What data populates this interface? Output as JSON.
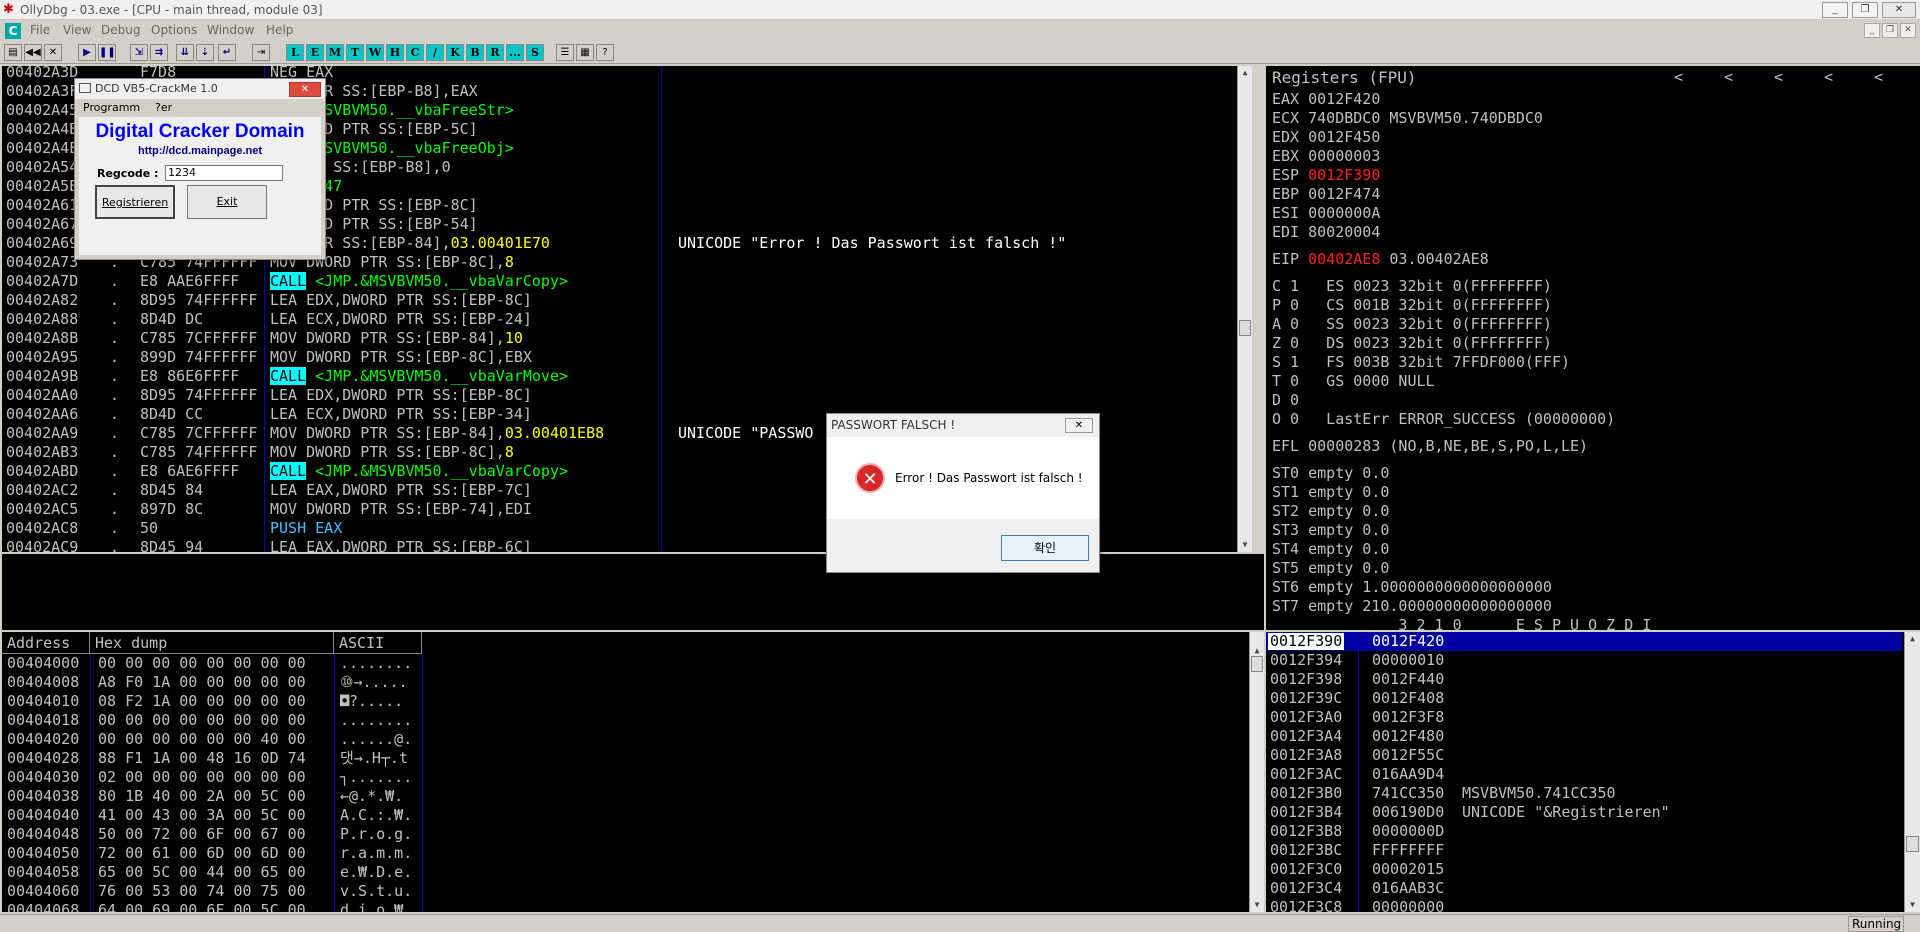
{
  "app": {
    "title": "OllyDbg - 03.exe - [CPU - main thread, module 03]",
    "menu": [
      "File",
      "View",
      "Debug",
      "Options",
      "Window",
      "Help"
    ],
    "mdi_icon": "C",
    "toolbar_letters": [
      "L",
      "E",
      "M",
      "T",
      "W",
      "H",
      "C",
      "/",
      "K",
      "B",
      "R",
      "...",
      "S"
    ]
  },
  "disasm": {
    "rows": [
      {
        "addr": "00402A3D",
        "m": "",
        "hex": "F7D8",
        "cmd": "NEG EAX",
        "cmt": ""
      },
      {
        "addr": "00402A3F",
        "m": "",
        "hex": "",
        "cmd": "ORD PTR SS:[EBP-B8],EAX",
        "cmt": ""
      },
      {
        "addr": "00402A45",
        "m": "",
        "hex": "",
        "cmd": "JMP.&MSVBVM50.__vbaFreeStr>",
        "cmt": ""
      },
      {
        "addr": "00402A4B",
        "m": "",
        "hex": "",
        "cmd": "X,DWORD PTR SS:[EBP-5C]",
        "cmt": ""
      },
      {
        "addr": "00402A4E",
        "m": "",
        "hex": "",
        "cmd": "JMP.&MSVBVM50.__vbaFreeObj>",
        "cmt": ""
      },
      {
        "addr": "00402A54",
        "m": "",
        "hex": "",
        "cmd": "RD PTR SS:[EBP-B8],0",
        "cmt": ""
      },
      {
        "addr": "00402A5B",
        "m": "",
        "hex": "",
        "cmd": "00402B47",
        "cmt": ""
      },
      {
        "addr": "00402A61",
        "m": "",
        "hex": "",
        "cmd": "X,DWORD PTR SS:[EBP-8C]",
        "cmt": ""
      },
      {
        "addr": "00402A67",
        "m": "",
        "hex": "",
        "cmd": "X,DWORD PTR SS:[EBP-54]",
        "cmt": ""
      },
      {
        "addr": "00402A69",
        "m": "",
        "hex": "",
        "cmd": "ORD PTR SS:[EBP-84],03.00401E70",
        "cmt": "UNICODE \"Error ! Das Passwort ist falsch !\""
      },
      {
        "addr": "00402A73",
        "m": ".",
        "hex": "C785 74FFFFFF",
        "cmd": "MOV DWORD PTR SS:[EBP-8C],8",
        "cmt": ""
      },
      {
        "addr": "00402A7D",
        "m": ".",
        "hex": "E8 AAE6FFFF",
        "cmd": "CALL <JMP.&MSVBVM50.__vbaVarCopy>",
        "cmt": ""
      },
      {
        "addr": "00402A82",
        "m": ".",
        "hex": "8D95 74FFFFFF",
        "cmd": "LEA EDX,DWORD PTR SS:[EBP-8C]",
        "cmt": ""
      },
      {
        "addr": "00402A88",
        "m": ".",
        "hex": "8D4D DC",
        "cmd": "LEA ECX,DWORD PTR SS:[EBP-24]",
        "cmt": ""
      },
      {
        "addr": "00402A8B",
        "m": ".",
        "hex": "C785 7CFFFFFF",
        "cmd": "MOV DWORD PTR SS:[EBP-84],10",
        "cmt": ""
      },
      {
        "addr": "00402A95",
        "m": ".",
        "hex": "899D 74FFFFFF",
        "cmd": "MOV DWORD PTR SS:[EBP-8C],EBX",
        "cmt": ""
      },
      {
        "addr": "00402A9B",
        "m": ".",
        "hex": "E8 86E6FFFF",
        "cmd": "CALL <JMP.&MSVBVM50.__vbaVarMove>",
        "cmt": ""
      },
      {
        "addr": "00402AA0",
        "m": ".",
        "hex": "8D95 74FFFFFF",
        "cmd": "LEA EDX,DWORD PTR SS:[EBP-8C]",
        "cmt": ""
      },
      {
        "addr": "00402AA6",
        "m": ".",
        "hex": "8D4D CC",
        "cmd": "LEA ECX,DWORD PTR SS:[EBP-34]",
        "cmt": ""
      },
      {
        "addr": "00402AA9",
        "m": ".",
        "hex": "C785 7CFFFFFF",
        "cmd": "MOV DWORD PTR SS:[EBP-84],03.00401EB8",
        "cmt": "UNICODE \"PASSWO"
      },
      {
        "addr": "00402AB3",
        "m": ".",
        "hex": "C785 74FFFFFF",
        "cmd": "MOV DWORD PTR SS:[EBP-8C],8",
        "cmt": ""
      },
      {
        "addr": "00402ABD",
        "m": ".",
        "hex": "E8 6AE6FFFF",
        "cmd": "CALL <JMP.&MSVBVM50.__vbaVarCopy>",
        "cmt": ""
      },
      {
        "addr": "00402AC2",
        "m": ".",
        "hex": "8D45 84",
        "cmd": "LEA EAX,DWORD PTR SS:[EBP-7C]",
        "cmt": ""
      },
      {
        "addr": "00402AC5",
        "m": ".",
        "hex": "897D 8C",
        "cmd": "MOV DWORD PTR SS:[EBP-74],EDI",
        "cmt": ""
      },
      {
        "addr": "00402AC8",
        "m": ".",
        "hex": "50",
        "cmd": "PUSH EAX",
        "cmt": ""
      },
      {
        "addr": "00402AC9",
        "m": ".",
        "hex": "8D45 94",
        "cmd": "LEA EAX,DWORD PTR SS:[EBP-6C]",
        "cmt": ""
      }
    ]
  },
  "registers": {
    "header": "Registers (FPU)",
    "arrows": [
      "<",
      "<",
      "<",
      "<",
      "<"
    ],
    "lines": [
      {
        "t": "EAX 0012F420",
        "c": ""
      },
      {
        "t": "ECX 740DBDC0 MSVBVM50.740DBDC0",
        "c": ""
      },
      {
        "t": "EDX 0012F450",
        "c": ""
      },
      {
        "t": "EBX 00000003",
        "c": ""
      },
      {
        "t": "ESP ",
        "v": "0012F390",
        "c": "red"
      },
      {
        "t": "EBP 0012F474",
        "c": ""
      },
      {
        "t": "ESI 0000000A",
        "c": ""
      },
      {
        "t": "EDI 80020004",
        "c": ""
      },
      {
        "t": "",
        "c": ""
      },
      {
        "t": "EIP ",
        "v": "00402AE8",
        "rest": " 03.00402AE8",
        "c": "red"
      },
      {
        "t": "",
        "c": ""
      },
      {
        "t": "C 1   ES 0023 32bit 0(FFFFFFFF)",
        "c": ""
      },
      {
        "t": "P 0   CS 001B 32bit 0(FFFFFFFF)",
        "c": ""
      },
      {
        "t": "A 0   SS 0023 32bit 0(FFFFFFFF)",
        "c": ""
      },
      {
        "t": "Z 0   DS 0023 32bit 0(FFFFFFFF)",
        "c": ""
      },
      {
        "t": "S 1   FS 003B 32bit 7FFDF000(FFF)",
        "c": ""
      },
      {
        "t": "T 0   GS 0000 NULL",
        "c": ""
      },
      {
        "t": "D 0",
        "c": ""
      },
      {
        "t": "O 0   LastErr ERROR_SUCCESS (00000000)",
        "c": ""
      },
      {
        "t": "",
        "c": ""
      },
      {
        "t": "EFL 00000283 (NO,B,NE,BE,S,PO,L,LE)",
        "c": ""
      },
      {
        "t": "",
        "c": ""
      },
      {
        "t": "ST0 empty 0.0",
        "c": ""
      },
      {
        "t": "ST1 empty 0.0",
        "c": ""
      },
      {
        "t": "ST2 empty 0.0",
        "c": ""
      },
      {
        "t": "ST3 empty 0.0",
        "c": ""
      },
      {
        "t": "ST4 empty 0.0",
        "c": ""
      },
      {
        "t": "ST5 empty 0.0",
        "c": ""
      },
      {
        "t": "ST6 empty 1.0000000000000000000",
        "c": ""
      },
      {
        "t": "ST7 empty 210.00000000000000000",
        "c": ""
      },
      {
        "t": "              3 2 1 0      E S P U O Z D I",
        "c": ""
      }
    ]
  },
  "dump": {
    "headers": [
      "Address",
      "Hex dump",
      "ASCII"
    ],
    "rows": [
      {
        "a": "00404000",
        "h": "00 00 00 00 00 00 00 00",
        "s": "........"
      },
      {
        "a": "00404008",
        "h": "A8 F0 1A 00 00 00 00 00",
        "s": "⑩→....."
      },
      {
        "a": "00404010",
        "h": "08 F2 1A 00 00 00 00 00",
        "s": "◘?....."
      },
      {
        "a": "00404018",
        "h": "00 00 00 00 00 00 00 00",
        "s": "........"
      },
      {
        "a": "00404020",
        "h": "00 00 00 00 00 00 40 00",
        "s": "......@."
      },
      {
        "a": "00404028",
        "h": "88 F1 1A 00 48 16 0D 74",
        "s": "댓→.H┬.t"
      },
      {
        "a": "00404030",
        "h": "02 00 00 00 00 00 00 00",
        "s": "┐......."
      },
      {
        "a": "00404038",
        "h": "80 1B 40 00 2A 00 5C 00",
        "s": "←@.*.₩."
      },
      {
        "a": "00404040",
        "h": "41 00 43 00 3A 00 5C 00",
        "s": "A.C.:.₩."
      },
      {
        "a": "00404048",
        "h": "50 00 72 00 6F 00 67 00",
        "s": "P.r.o.g."
      },
      {
        "a": "00404050",
        "h": "72 00 61 00 6D 00 6D 00",
        "s": "r.a.m.m."
      },
      {
        "a": "00404058",
        "h": "65 00 5C 00 44 00 65 00",
        "s": "e.₩.D.e."
      },
      {
        "a": "00404060",
        "h": "76 00 53 00 74 00 75 00",
        "s": "v.S.t.u."
      },
      {
        "a": "00404068",
        "h": "64 00 69 00 6F 00 5C 00",
        "s": "d.i.o.₩."
      }
    ]
  },
  "stack": {
    "rows": [
      {
        "a": "0012F390",
        "v": "0012F420",
        "c": ""
      },
      {
        "a": "0012F394",
        "v": "00000010",
        "c": ""
      },
      {
        "a": "0012F398",
        "v": "0012F440",
        "c": ""
      },
      {
        "a": "0012F39C",
        "v": "0012F408",
        "c": ""
      },
      {
        "a": "0012F3A0",
        "v": "0012F3F8",
        "c": ""
      },
      {
        "a": "0012F3A4",
        "v": "0012F480",
        "c": ""
      },
      {
        "a": "0012F3A8",
        "v": "0012F55C",
        "c": ""
      },
      {
        "a": "0012F3AC",
        "v": "016AA9D4",
        "c": ""
      },
      {
        "a": "0012F3B0",
        "v": "741CC350",
        "c": "MSVBVM50.741CC350"
      },
      {
        "a": "0012F3B4",
        "v": "006190D0",
        "c": "UNICODE \"&Registrieren\""
      },
      {
        "a": "0012F3B8",
        "v": "0000000D",
        "c": ""
      },
      {
        "a": "0012F3BC",
        "v": "FFFFFFFF",
        "c": ""
      },
      {
        "a": "0012F3C0",
        "v": "00002015",
        "c": ""
      },
      {
        "a": "0012F3C4",
        "v": "016AAB3C",
        "c": ""
      },
      {
        "a": "0012F3C8",
        "v": "00000000",
        "c": ""
      }
    ]
  },
  "crackme": {
    "title": "DCD VB5-CrackMe 1.0",
    "menu1": "Programm",
    "menu2": "?er",
    "heading": "Digital Cracker Domain",
    "url": "http://dcd.mainpage.net",
    "regcode_label": "Regcode :",
    "regcode_value": "1234",
    "btn_register": "Registrieren",
    "btn_exit": "Exit"
  },
  "msgbox": {
    "title": "PASSWORT FALSCH !",
    "message": "Error ! Das Passwort ist falsch !",
    "ok": "확인"
  },
  "status": {
    "state": "Running"
  }
}
